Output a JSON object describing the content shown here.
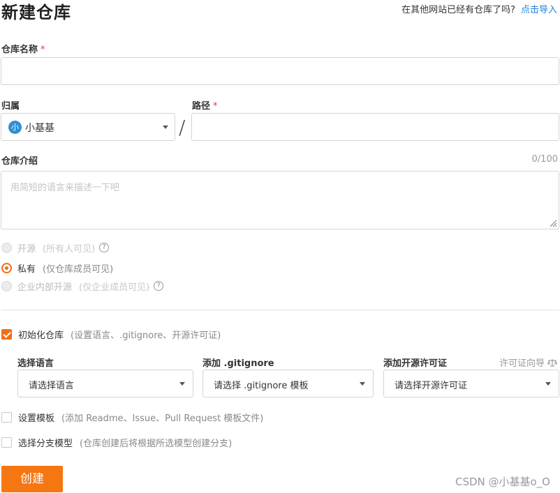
{
  "header": {
    "title": "新建仓库",
    "import_hint": "在其他网站已经有仓库了吗?",
    "import_link": "点击导入"
  },
  "repo_name": {
    "label": "仓库名称",
    "required_mark": "*",
    "value": ""
  },
  "owner": {
    "label": "归属",
    "avatar_text": "小",
    "selected": "小基基",
    "avatar_color": "#2e8fd3"
  },
  "separator": "/",
  "path": {
    "label": "路径",
    "required_mark": "*",
    "value": ""
  },
  "description": {
    "label": "仓库介绍",
    "counter": "0/100",
    "placeholder": "用简短的语言来描述一下吧"
  },
  "visibility": {
    "options": [
      {
        "label": "开源",
        "desc": "(所有人可见)",
        "selected": false,
        "disabled": true,
        "has_help": true
      },
      {
        "label": "私有",
        "desc": "(仅仓库成员可见)",
        "selected": true,
        "disabled": false,
        "has_help": false
      },
      {
        "label": "企业内部开源",
        "desc": "(仅企业成员可见)",
        "selected": false,
        "disabled": true,
        "has_help": true
      }
    ]
  },
  "init_repo": {
    "label": "初始化仓库",
    "desc": "(设置语言、.gitignore、开源许可证)",
    "checked": true
  },
  "language": {
    "label": "选择语言",
    "selected": "请选择语言"
  },
  "gitignore": {
    "label": "添加 .gitignore",
    "selected": "请选择 .gitignore 模板"
  },
  "license": {
    "label": "添加开源许可证",
    "guide": "许可证向导",
    "selected": "请选择开源许可证"
  },
  "template": {
    "label": "设置模板",
    "desc": "(添加 Readme、Issue、Pull Request 模板文件)",
    "checked": false
  },
  "branch_model": {
    "label": "选择分支模型",
    "desc": "(仓库创建后将根据所选模型创建分支)",
    "checked": false
  },
  "create_button": "创建",
  "watermark": "CSDN @小基基o_O",
  "colors": {
    "accent": "#f67611",
    "link": "#1e7fd8",
    "required": "#e53935"
  },
  "icons": {
    "help": "question-circle-icon",
    "license_guide": "scale-icon",
    "dropdown": "caret-down-icon"
  }
}
